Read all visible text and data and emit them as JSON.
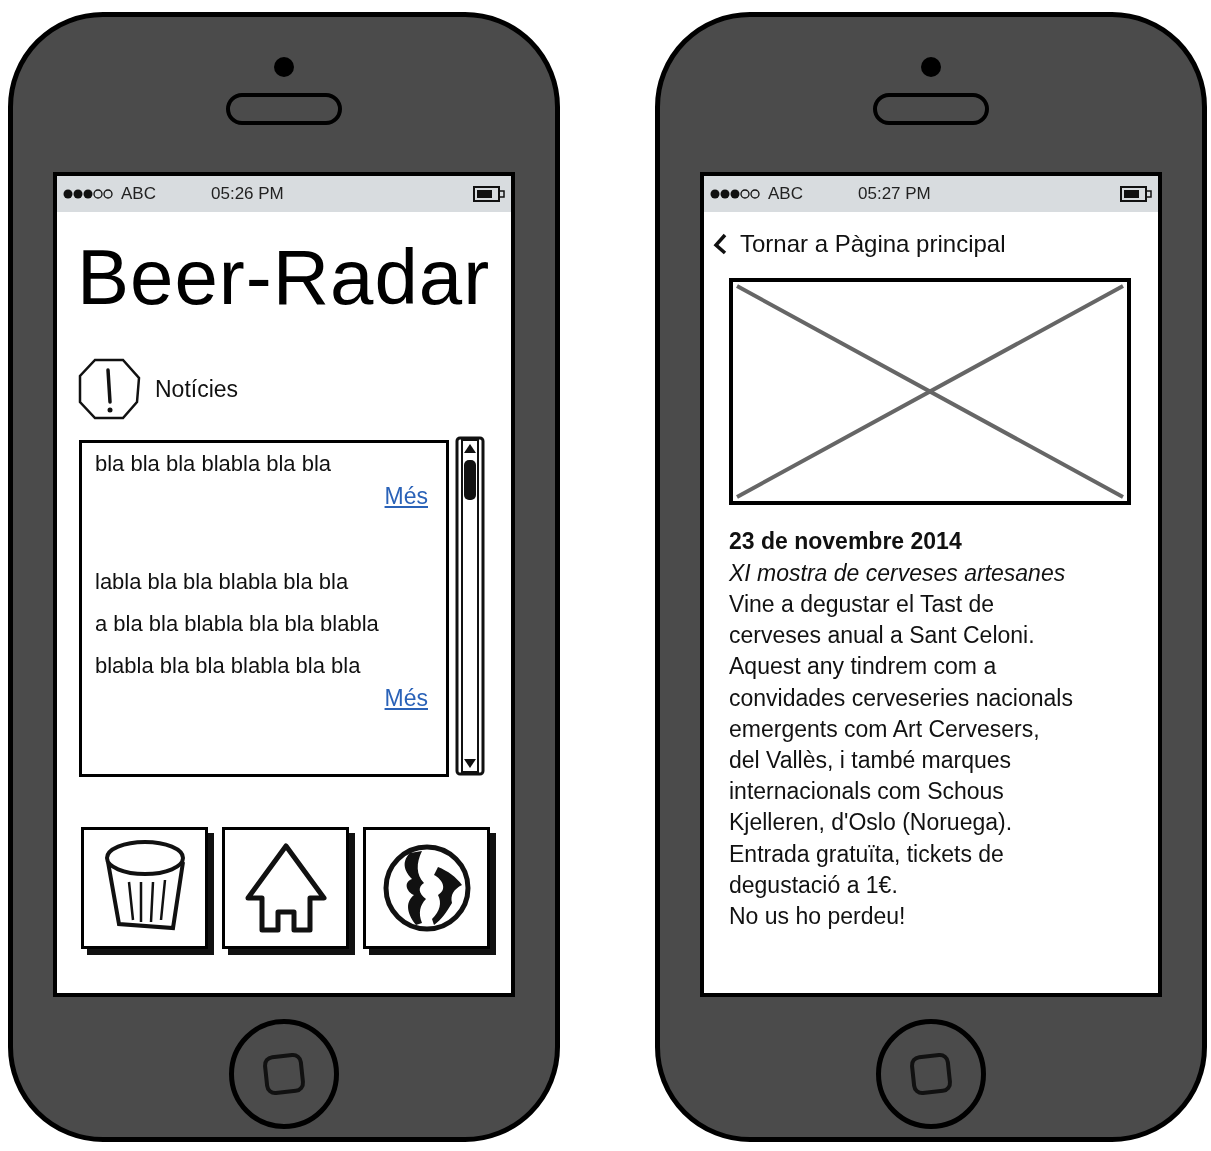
{
  "screens": [
    {
      "kind": "home",
      "status_bar": {
        "carrier": "ABC",
        "time": "05:26 PM"
      },
      "title": "Beer-Radar",
      "section": "Notícies",
      "news": [
        {
          "text": "bla bla bla blabla bla bla",
          "link": "Més"
        },
        {
          "text": "labla bla bla blabla bla bla\na bla bla blabla bla bla blabla\nblabla bla bla blabla bla bla",
          "link": "Més"
        }
      ]
    },
    {
      "kind": "detail",
      "status_bar": {
        "carrier": "ABC",
        "time": "05:27 PM"
      },
      "back": "Tornar a Pàgina principal",
      "date": "23 de novembre 2014",
      "subtitle": "XI mostra de cerveses artesanes",
      "body": "Vine a degustar el Tast de\ncerveses anual a Sant Celoni.\nAquest any tindrem com a\nconvidades cerveseries nacionals\nemergents com Art Cervesers,\ndel Vallès, i també marques\ninternacionals com Schous\nKjelleren, d'Oslo (Noruega).\nEntrada gratuïta, tickets de\ndegustació a 1€.\nNo us ho perdeu!"
    }
  ]
}
